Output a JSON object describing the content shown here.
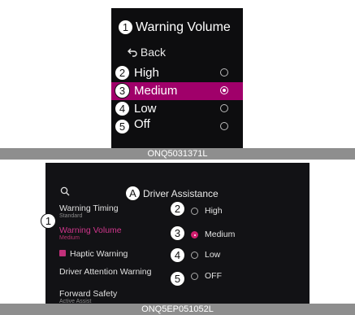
{
  "top_figure": {
    "title": "Warning Volume",
    "back_label": "Back",
    "options": [
      {
        "callout": "2",
        "label": "High",
        "selected": false
      },
      {
        "callout": "3",
        "label": "Medium",
        "selected": true
      },
      {
        "callout": "4",
        "label": "Low",
        "selected": false
      },
      {
        "callout": "5",
        "label": "Off",
        "selected": false
      }
    ],
    "title_callout": "1",
    "caption": "ONQ5031371L"
  },
  "bottom_figure": {
    "title_callout": "A",
    "title": "Driver Assistance",
    "menu": [
      {
        "label": "Warning Timing",
        "sub": "Standard"
      },
      {
        "label": "Warning Volume",
        "sub": "Medium",
        "active": true
      },
      {
        "label": "Haptic Warning",
        "checked": true
      },
      {
        "label": "Driver Attention Warning"
      },
      {
        "label": "Forward Safety",
        "sub": "Active Assist"
      }
    ],
    "menu_callout": "1",
    "options": [
      {
        "callout": "2",
        "label": "High",
        "selected": false
      },
      {
        "callout": "3",
        "label": "Medium",
        "selected": true
      },
      {
        "callout": "4",
        "label": "Low",
        "selected": false
      },
      {
        "callout": "5",
        "label": "OFF",
        "selected": false
      }
    ],
    "caption": "ONQ5EP051052L"
  },
  "colors": {
    "selected_highlight": "#a0006a",
    "accent_pink": "#d01e6e",
    "caption_bar": "#8e8e8e"
  },
  "icons": [
    "back-arrow-icon",
    "search-icon",
    "radio-button-icon",
    "checkbox-icon"
  ]
}
